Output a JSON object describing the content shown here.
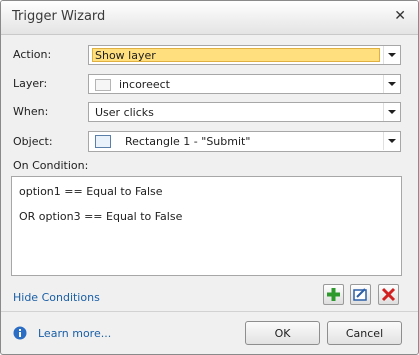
{
  "window": {
    "title": "Trigger Wizard",
    "close_glyph": "✕"
  },
  "form": {
    "action": {
      "label": "Action:",
      "value": "Show layer",
      "state": "selected"
    },
    "layer": {
      "label": "Layer:",
      "value": "incoreect",
      "icon": "layer-icon"
    },
    "when": {
      "label": "When:",
      "value": "User clicks"
    },
    "object": {
      "label": "Object:",
      "value": "Rectangle 1 - \"Submit\"",
      "icon": "rectangle-icon"
    }
  },
  "conditions": {
    "label": "On Condition:",
    "items": [
      "option1 == Equal to False",
      "OR option3 == Equal to False"
    ]
  },
  "links": {
    "hide_conditions": "Hide Conditions",
    "learn_more": "Learn more..."
  },
  "condition_toolbar": [
    {
      "name": "add-condition",
      "icon": "plus-icon",
      "color": "#2e9a2e"
    },
    {
      "name": "edit-condition",
      "icon": "edit-icon",
      "color": "#2b5fa8"
    },
    {
      "name": "delete-condition",
      "icon": "delete-icon",
      "color": "#d22020"
    }
  ],
  "buttons": {
    "ok": "OK",
    "cancel": "Cancel"
  },
  "colors": {
    "selection_highlight": "#ffdf7e",
    "link": "#1a5fa6"
  }
}
